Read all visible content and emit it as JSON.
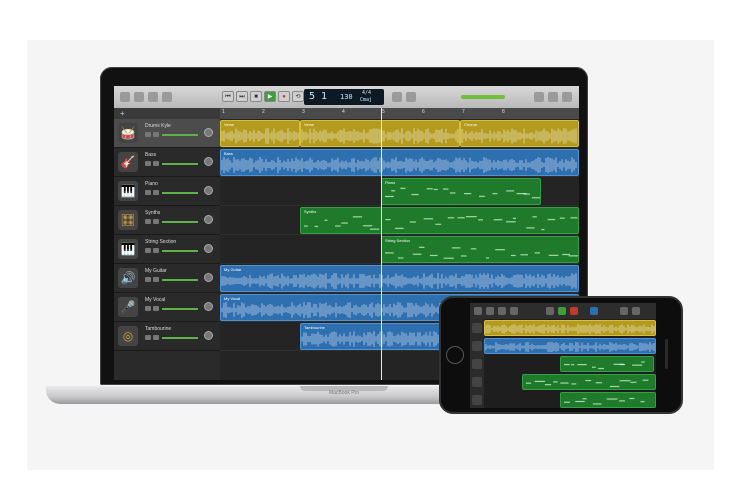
{
  "laptop": {
    "brand_label": "MacBook Pro",
    "toolbar": {
      "transport_buttons": [
        "⏮",
        "⏭",
        "■",
        "▶",
        "●",
        "⟲"
      ],
      "lcd": {
        "position": "5 1",
        "tempo": "130",
        "signature": "4/4",
        "key": "Cmaj"
      }
    },
    "ruler_marks": [
      "1",
      "2",
      "3",
      "4",
      "5",
      "6",
      "7",
      "8"
    ],
    "tracks": [
      {
        "name": "Drums Kyle",
        "icon": "drum-kit-icon",
        "glyph": "🥁"
      },
      {
        "name": "Bass",
        "icon": "bass-guitar-icon",
        "glyph": "🎸"
      },
      {
        "name": "Piano",
        "icon": "piano-icon",
        "glyph": "🎹"
      },
      {
        "name": "Synths",
        "icon": "synth-icon",
        "glyph": "🎛"
      },
      {
        "name": "String Section",
        "icon": "keyboard-icon",
        "glyph": "🎹"
      },
      {
        "name": "My Guitar",
        "icon": "amp-icon",
        "glyph": "🔊"
      },
      {
        "name": "My Vocal",
        "icon": "microphone-icon",
        "glyph": "🎤"
      },
      {
        "name": "Tambourine",
        "icon": "tambourine-icon",
        "glyph": "◎"
      }
    ],
    "regions": {
      "drums_a": "Verse",
      "drums_b": "Verse",
      "drums_c": "Chorus",
      "bass": "Bass",
      "piano": "Piano",
      "synths": "Synths",
      "strings": "String Section",
      "guitar": "My Guitar",
      "vocal": "My Vocal",
      "tambourine": "Tambourine"
    }
  },
  "phone": {
    "track_icons": [
      "drum-kit-icon",
      "bass-guitar-icon",
      "piano-icon",
      "synth-icon",
      "keyboard-icon"
    ]
  },
  "colors": {
    "drummer": "#b49a1f",
    "audio": "#2e6fb0",
    "midi": "#1f7a2c",
    "play": "#3f9e3a",
    "record": "#c0392b"
  }
}
